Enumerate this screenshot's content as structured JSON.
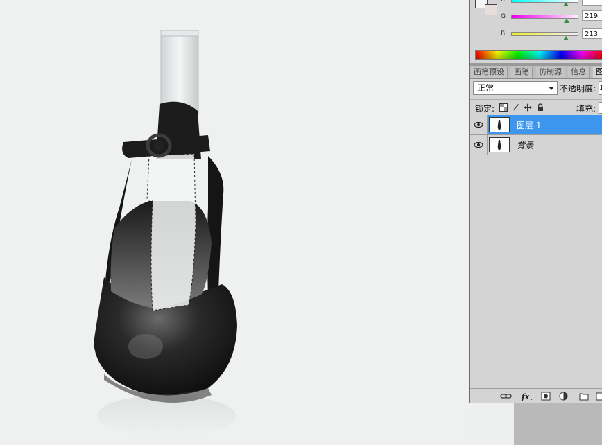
{
  "canvas": {
    "description_icons": [
      "shoe-photo",
      "selection-marquee"
    ]
  },
  "color_panel": {
    "channels": [
      {
        "label": "R",
        "value": ""
      },
      {
        "label": "G",
        "value": "219"
      },
      {
        "label": "B",
        "value": "213"
      }
    ]
  },
  "tabs": [
    "画笔预设",
    "画笔",
    "仿制源",
    "信息",
    "图"
  ],
  "layers_panel": {
    "blend_mode": "正常",
    "opacity_label": "不透明度:",
    "opacity_value": "1",
    "lock_label": "锁定:",
    "fill_label": "填充:",
    "layers": [
      {
        "name": "图层 1",
        "selected": true
      },
      {
        "name": "背景",
        "selected": false
      }
    ]
  },
  "bottom_icons": [
    "link-icon",
    "fx-icon",
    "mask-icon",
    "adjustment-icon",
    "folder-icon",
    "new-layer-icon"
  ],
  "colors": {
    "selection": "#3d97ee",
    "panel_bg": "#d4d4d4"
  }
}
